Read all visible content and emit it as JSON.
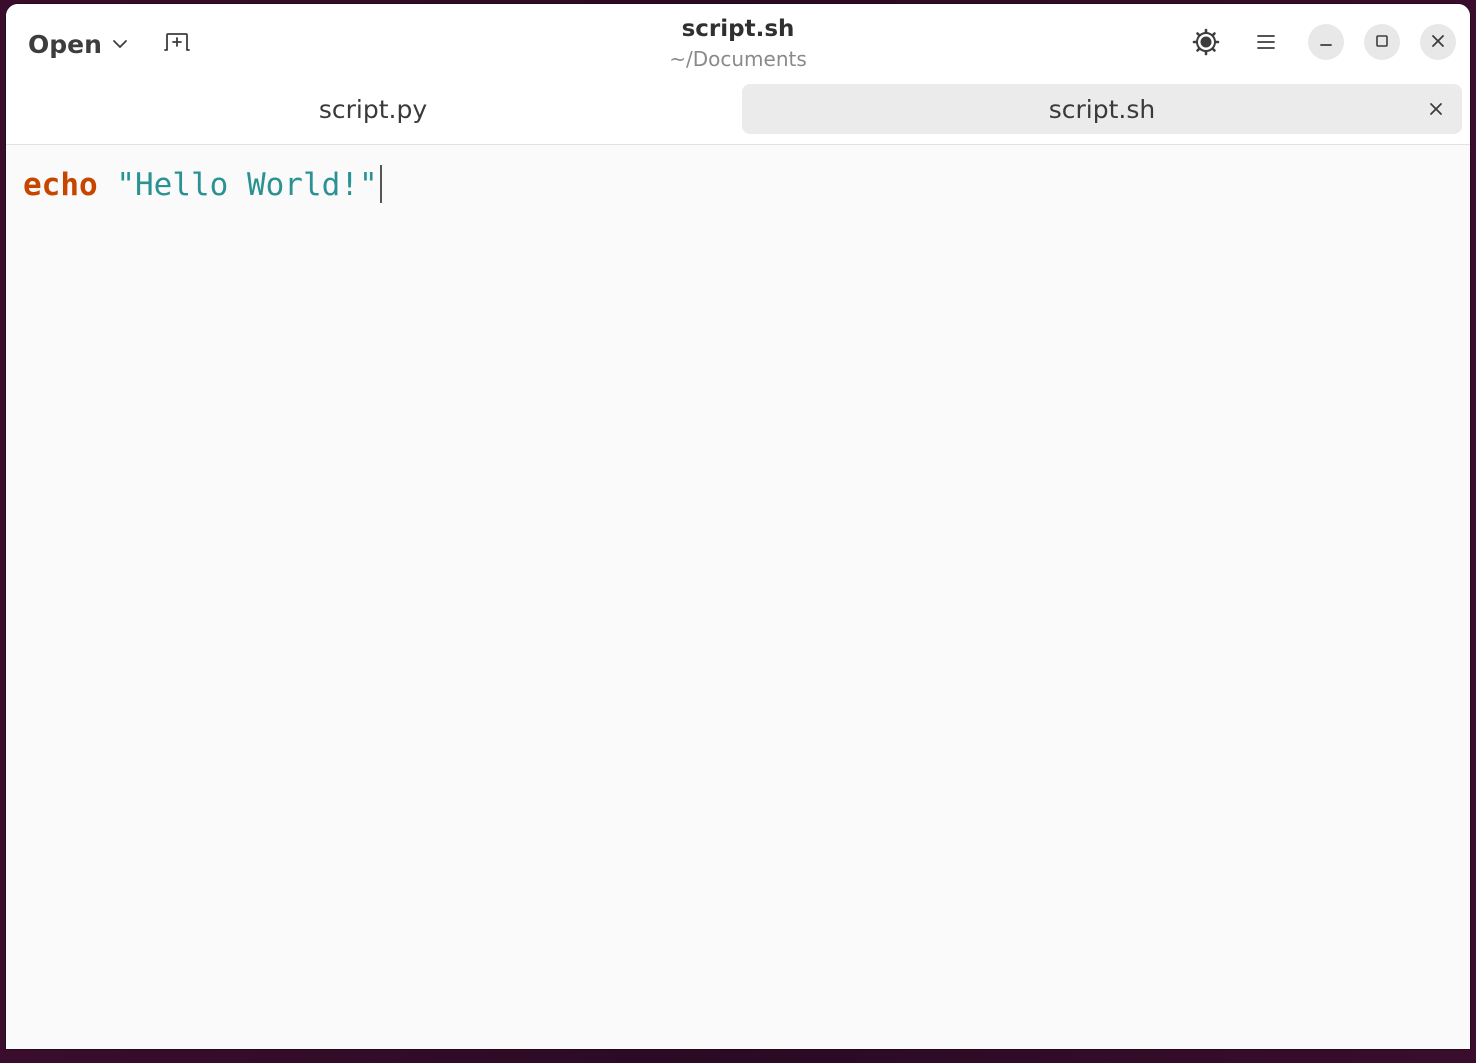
{
  "headerbar": {
    "open_label": "Open",
    "title": "script.sh",
    "subtitle": "~/Documents",
    "icons": {
      "open_menu": "chevron-down-icon",
      "new_tab": "new-tab-icon",
      "settings": "gear-icon",
      "menu": "hamburger-menu-icon",
      "minimize": "minimize-icon",
      "maximize": "maximize-icon",
      "close": "close-icon"
    }
  },
  "tabs": [
    {
      "label": "script.py",
      "active": false
    },
    {
      "label": "script.sh",
      "active": true
    }
  ],
  "editor": {
    "lines": [
      {
        "keyword": "echo",
        "string": "\"Hello World!\""
      }
    ]
  },
  "colors": {
    "keyword": "#c64600",
    "string": "#2a9292",
    "editor_bg": "#fafafa",
    "active_tab_bg": "#ebebeb"
  }
}
